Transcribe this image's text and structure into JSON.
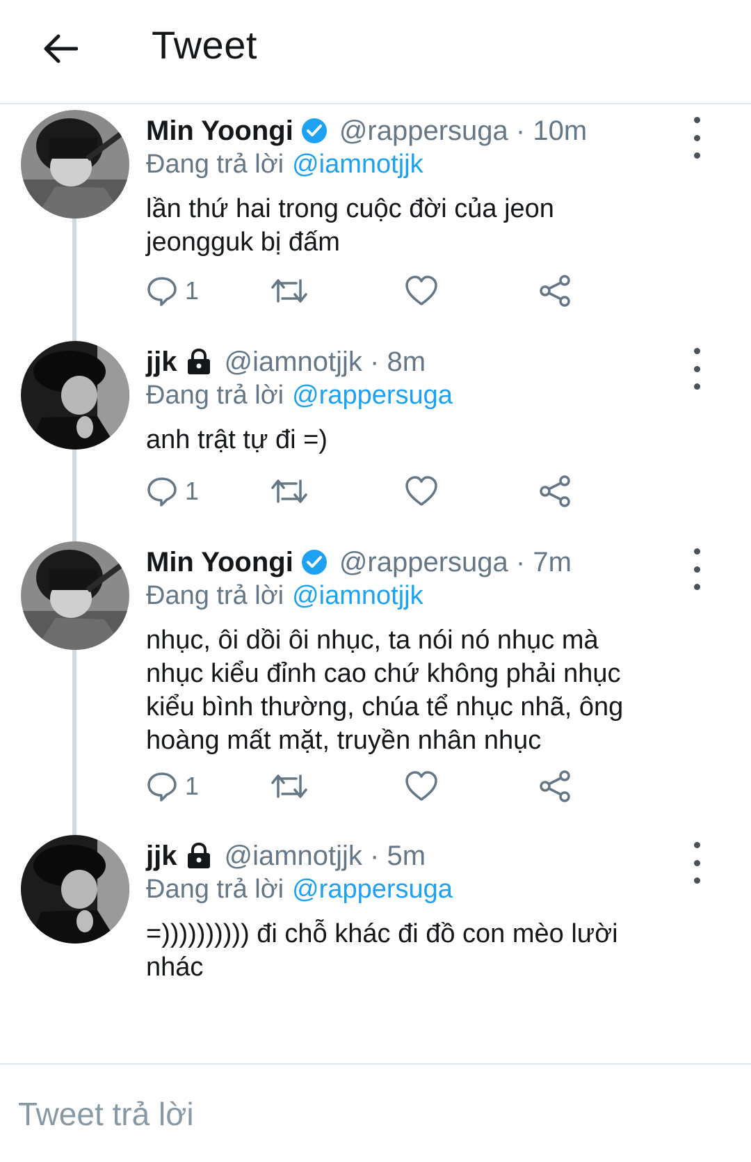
{
  "header": {
    "title": "Tweet"
  },
  "icons": {
    "back": "arrow-left-icon",
    "verified": "verified-badge-icon",
    "locked": "lock-icon",
    "more": "more-vertical-icon",
    "reply": "comment-icon",
    "retweet": "retweet-icon",
    "like": "heart-icon",
    "share": "share-icon"
  },
  "colors": {
    "accent": "#1da1f2",
    "secondary_text": "#657786",
    "thread_line": "#cfd9de"
  },
  "tweets": [
    {
      "name": "Min Yoongi",
      "verified": true,
      "locked": false,
      "meta": "@rappersuga · 10m",
      "replying_label": "Đang trả lời",
      "replying_to": "@iamnotjjk",
      "text_lines": [
        "lần thứ hai trong cuộc đời của jeon",
        "jeongguk bị đấm"
      ],
      "reply_count": "1"
    },
    {
      "name": "jjk",
      "verified": false,
      "locked": true,
      "meta": "@iamnotjjk · 8m",
      "replying_label": "Đang trả lời",
      "replying_to": "@rappersuga",
      "text_lines": [
        "anh trật tự đi =)"
      ],
      "reply_count": "1"
    },
    {
      "name": "Min Yoongi",
      "verified": true,
      "locked": false,
      "meta": "@rappersuga · 7m",
      "replying_label": "Đang trả lời",
      "replying_to": "@iamnotjjk",
      "text_lines": [
        "nhục, ôi dồi ôi nhục, ta nói nó nhục mà",
        "nhục kiểu đỉnh cao chứ không phải nhục",
        "kiểu bình thường, chúa tể nhục nhã, ông",
        "hoàng mất mặt, truyền nhân nhục"
      ],
      "reply_count": "1"
    },
    {
      "name": "jjk",
      "verified": false,
      "locked": true,
      "meta": "@iamnotjjk · 5m",
      "replying_label": "Đang trả lời",
      "replying_to": "@rappersuga",
      "text_lines": [
        "=)))))))))) đi chỗ khác đi đồ con mèo lười",
        "nhác"
      ]
    }
  ],
  "compose": {
    "placeholder": "Tweet trả lời"
  }
}
